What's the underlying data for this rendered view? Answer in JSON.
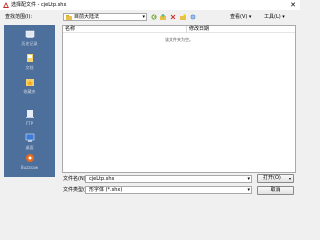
{
  "window": {
    "title": "选择配文件 - cjeLtp.shx",
    "close_glyph": "✕"
  },
  "toolbar": {
    "lookin_label": "查找范围(I):",
    "lookin_value": "目前大陆法",
    "view_label": "查看(V)",
    "tools_label": "工具(L)",
    "icons": [
      "back-icon",
      "up-folder-icon",
      "delete-icon",
      "new-folder-icon",
      "search-web-icon"
    ]
  },
  "places": [
    {
      "label": "历史记录",
      "icon": "history-icon"
    },
    {
      "label": "文档",
      "icon": "documents-icon"
    },
    {
      "label": "收藏夹",
      "icon": "favorites-icon"
    },
    {
      "label": "FTP",
      "icon": "ftp-icon"
    },
    {
      "label": "桌面",
      "icon": "desktop-icon"
    },
    {
      "label": "Buzzsaw",
      "icon": "buzzsaw-icon"
    }
  ],
  "file_list": {
    "columns": [
      "名称",
      "修改日期"
    ],
    "empty_message": "该文件夹为空。"
  },
  "filename": {
    "label": "文件名(N):",
    "value": "cjeLtp.shx"
  },
  "filetype": {
    "label": "文件类型(T):",
    "value": "形字体 (*.shx)"
  },
  "buttons": {
    "open": "打开(O)",
    "cancel": "取消"
  },
  "colors": {
    "places_bg": "#4d6f9c",
    "window_bg": "#f0f0f0",
    "title_icon": "#c62828"
  }
}
